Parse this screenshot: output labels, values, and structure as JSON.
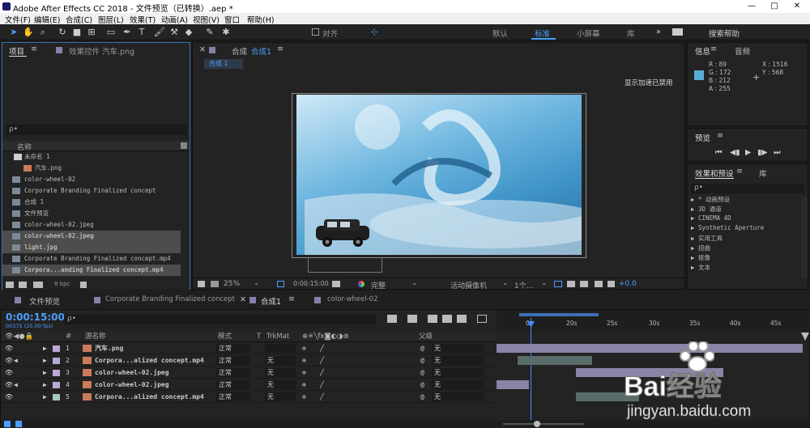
{
  "title": "Adobe After Effects CC 2018 - 文件预览（已转换）.aep *",
  "window_controls": {
    "minimize": "—",
    "maximize": "□",
    "close": "✕"
  },
  "menu": [
    "文件(F)",
    "编辑(E)",
    "合成(C)",
    "图层(L)",
    "效果(T)",
    "动画(A)",
    "视图(V)",
    "窗口",
    "帮助(H)"
  ],
  "toolbar": {
    "align_label": "对齐",
    "workspaces": [
      "默认",
      "标准",
      "小屏幕",
      "库"
    ],
    "more": "»",
    "search_help": "搜索帮助"
  },
  "project": {
    "tab": "项目",
    "effects_tab": "效果控件 汽车.png",
    "search_placeholder": "ρ•",
    "name_header": "名称",
    "items": [
      {
        "name": "未命名 1",
        "selected": false
      },
      {
        "name": "汽车.png",
        "selected": false
      },
      {
        "name": "color-wheel-02",
        "selected": false
      },
      {
        "name": "Corporate Branding  Finalized concept",
        "selected": false
      },
      {
        "name": "合成 1",
        "selected": false
      },
      {
        "name": "文件预览",
        "selected": false
      },
      {
        "name": "color-wheel-02.jpeg",
        "selected": false
      },
      {
        "name": "color-wheel-02.jpeg",
        "selected": true
      },
      {
        "name": "light.jpg",
        "selected": true
      },
      {
        "name": "Corporate Branding  Finalized concept.mp4",
        "selected": false
      },
      {
        "name": "Corpora...anding  Finalized concept.mp4",
        "selected": true
      }
    ],
    "bpc": "8 bpc"
  },
  "composition": {
    "tab": "合成",
    "comp_name": "合成1",
    "subtab": "合成 1",
    "notice": "显示加速已禁用",
    "zoom": "25%",
    "timecode": "0:00:15:00",
    "quality": "完整",
    "camera": "活动摄像机",
    "views": "1个...",
    "exposure": "+0.0"
  },
  "info": {
    "tab": "信息",
    "audio_tab": "音频",
    "r": "R : 89",
    "g": "G : 172",
    "b": "B : 212",
    "a": "A : 255",
    "x": "X : 1516",
    "y": "Y : 568",
    "color": "#59acd4"
  },
  "preview": {
    "tab": "预览"
  },
  "effects": {
    "tab": "效果和预设",
    "lib_tab": "库",
    "search_placeholder": "ρ•",
    "items": [
      "▶ * 动画预设",
      "▶ 3D 通道",
      "▶ CINEMA 4D",
      "▶ Synthetic Aperture",
      "▶ 实用工具",
      "▶ 扭曲",
      "▶ 抠像",
      "▶ 文本"
    ]
  },
  "timeline": {
    "tabs": [
      "文件预览",
      "Corporate Branding  Finalized concept",
      "合成1",
      "color-wheel-02"
    ],
    "timecode": "0:00:15:00",
    "timecode_sub": "00375 (25.00 fps)",
    "search_placeholder": "ρ•",
    "headers": {
      "num": "#",
      "source": "源名称",
      "mode": "模式",
      "t": "T",
      "trkmat": "TrkMat",
      "parent": "父级"
    },
    "ruler": [
      "0s",
      "20s",
      "25s",
      "30s",
      "35s",
      "40s",
      "45s"
    ],
    "layers": [
      {
        "num": "1",
        "name": "汽车.png",
        "mode": "正常",
        "trkmat": "",
        "parent": "无",
        "color": "#b9a8d6"
      },
      {
        "num": "2",
        "name": "Corpora...alized concept.mp4",
        "mode": "正常",
        "trkmat": "无",
        "parent": "无",
        "color": "#b9a8d6"
      },
      {
        "num": "3",
        "name": "color-wheel-02.jpeg",
        "mode": "正常",
        "trkmat": "无",
        "parent": "无",
        "color": "#b9a8d6"
      },
      {
        "num": "4",
        "name": "color-wheel-02.jpeg",
        "mode": "正常",
        "trkmat": "无",
        "parent": "无",
        "color": "#b9a8d6"
      },
      {
        "num": "5",
        "name": "Corpora...alized concept.mp4",
        "mode": "正常",
        "trkmat": "无",
        "parent": "无",
        "color": "#a7c9c3"
      }
    ]
  },
  "watermark": {
    "brand": "Bai经验",
    "url": "jingyan.baidu.com"
  }
}
